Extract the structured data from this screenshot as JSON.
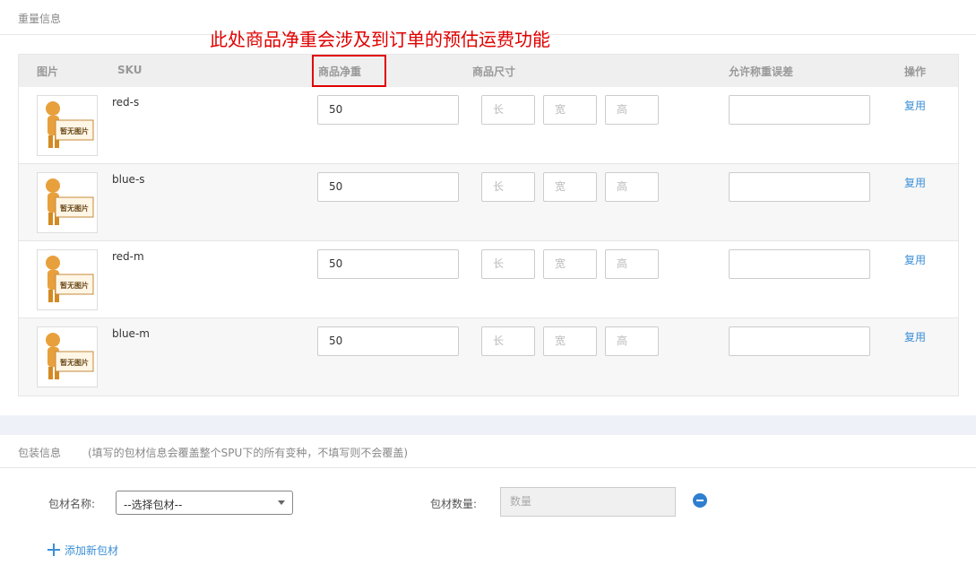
{
  "weight_section": {
    "title": "重量信息"
  },
  "annotation": {
    "text": "此处商品净重会涉及到订单的预估运费功能",
    "color": "#e00000"
  },
  "table": {
    "headers": {
      "image": "图片",
      "sku": "SKU",
      "net_weight": "商品净重",
      "size": "商品尺寸",
      "tolerance": "允许称重误差",
      "action": "操作"
    },
    "no_image_text": "暂无图片",
    "size_placeholders": {
      "length": "长",
      "width": "宽",
      "height": "高"
    },
    "rows": [
      {
        "sku": "red-s",
        "net_weight": "50",
        "tolerance": "",
        "action": "复用"
      },
      {
        "sku": "blue-s",
        "net_weight": "50",
        "tolerance": "",
        "action": "复用"
      },
      {
        "sku": "red-m",
        "net_weight": "50",
        "tolerance": "",
        "action": "复用"
      },
      {
        "sku": "blue-m",
        "net_weight": "50",
        "tolerance": "",
        "action": "复用"
      }
    ]
  },
  "packaging_section": {
    "title": "包装信息",
    "note": "(填写的包材信息会覆盖整个SPU下的所有变种，不填写则不会覆盖)",
    "material_label": "包材名称:",
    "material_select": "--选择包材--",
    "quantity_label": "包材数量:",
    "quantity_placeholder": "数量",
    "add_link": "添加新包材"
  },
  "colors": {
    "accent": "#3b8fd6",
    "annotation_box": "#e00000"
  }
}
